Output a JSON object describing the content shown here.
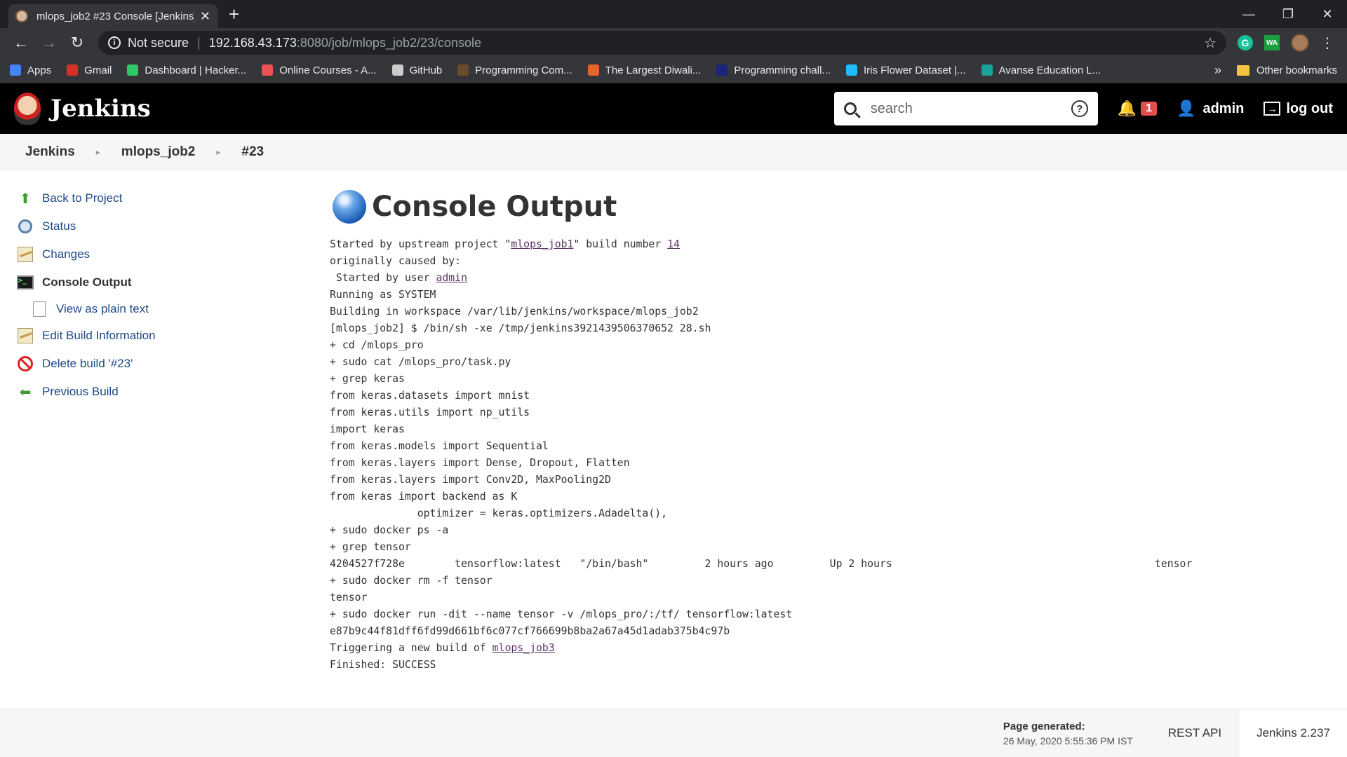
{
  "browser": {
    "tab_title": "mlops_job2 #23 Console [Jenkins]",
    "url_security": "Not secure",
    "url_host": "192.168.43.173",
    "url_path": ":8080/job/mlops_job2/23/console",
    "bookmarks": [
      {
        "label": "Apps",
        "icon": "apps-grid-icon",
        "color": "#4285f4"
      },
      {
        "label": "Gmail",
        "icon": "gmail-icon",
        "color": "#d93025"
      },
      {
        "label": "Dashboard | Hacker...",
        "icon": "hackerrank-icon",
        "color": "#2ec866"
      },
      {
        "label": "Online Courses - A...",
        "icon": "udemy-icon",
        "color": "#ec5252"
      },
      {
        "label": "GitHub",
        "icon": "github-icon",
        "color": "#cccccc"
      },
      {
        "label": "Programming Com...",
        "icon": "codechef-icon",
        "color": "#6b4a2e"
      },
      {
        "label": "The Largest Diwali...",
        "icon": "site-icon",
        "color": "#e8622b"
      },
      {
        "label": "Programming chall...",
        "icon": "site-icon",
        "color": "#1a237e"
      },
      {
        "label": "Iris Flower Dataset |...",
        "icon": "kaggle-icon",
        "color": "#20beff"
      },
      {
        "label": "Avanse Education L...",
        "icon": "site-icon",
        "color": "#1aa39a"
      }
    ],
    "bookmarks_overflow": "»",
    "other_bookmarks": "Other bookmarks"
  },
  "header": {
    "logo_text": "Jenkins",
    "search_placeholder": "search",
    "notification_count": "1",
    "user": "admin",
    "logout": "log out"
  },
  "breadcrumbs": [
    "Jenkins",
    "mlops_job2",
    "#23"
  ],
  "side_panel": {
    "items": [
      {
        "label": "Back to Project"
      },
      {
        "label": "Status"
      },
      {
        "label": "Changes"
      },
      {
        "label": "Console Output"
      },
      {
        "label": "View as plain text"
      },
      {
        "label": "Edit Build Information"
      },
      {
        "label": "Delete build '#23'"
      },
      {
        "label": "Previous Build"
      }
    ]
  },
  "console": {
    "title": "Console Output",
    "lines": [
      [
        "Started by upstream project \"",
        {
          "link": "mlops_job1"
        },
        "\" build number ",
        {
          "link": "14"
        }
      ],
      [
        "originally caused by:"
      ],
      [
        " Started by user ",
        {
          "link": "admin"
        }
      ],
      [
        "Running as SYSTEM"
      ],
      [
        "Building in workspace /var/lib/jenkins/workspace/mlops_job2"
      ],
      [
        "[mlops_job2] $ /bin/sh -xe /tmp/jenkins3921439506370652 28.sh"
      ],
      [
        "+ cd /mlops_pro"
      ],
      [
        "+ sudo cat /mlops_pro/task.py"
      ],
      [
        "+ grep keras"
      ],
      [
        "from keras.datasets import mnist"
      ],
      [
        "from keras.utils import np_utils"
      ],
      [
        "import keras"
      ],
      [
        "from keras.models import Sequential"
      ],
      [
        "from keras.layers import Dense, Dropout, Flatten"
      ],
      [
        "from keras.layers import Conv2D, MaxPooling2D"
      ],
      [
        "from keras import backend as K"
      ],
      [
        "              optimizer = keras.optimizers.Adadelta(),"
      ],
      [
        "+ sudo docker ps -a"
      ],
      [
        "+ grep tensor"
      ],
      [
        "4204527f728e        tensorflow:latest   \"/bin/bash\"         2 hours ago         Up 2 hours                                          tensor"
      ],
      [
        "+ sudo docker rm -f tensor"
      ],
      [
        "tensor"
      ],
      [
        "+ sudo docker run -dit --name tensor -v /mlops_pro/:/tf/ tensorflow:latest"
      ],
      [
        "e87b9c44f81dff6fd99d661bf6c077cf766699b8ba2a67a45d1adab375b4c97b"
      ],
      [
        "Triggering a new build of ",
        {
          "link": "mlops_job3"
        }
      ],
      [
        "Finished: SUCCESS"
      ]
    ]
  },
  "footer": {
    "page_generated_label": "Page generated:",
    "page_generated_date": "26 May, 2020 5:55:36 PM IST",
    "rest_api": "REST API",
    "version": "Jenkins 2.237"
  }
}
